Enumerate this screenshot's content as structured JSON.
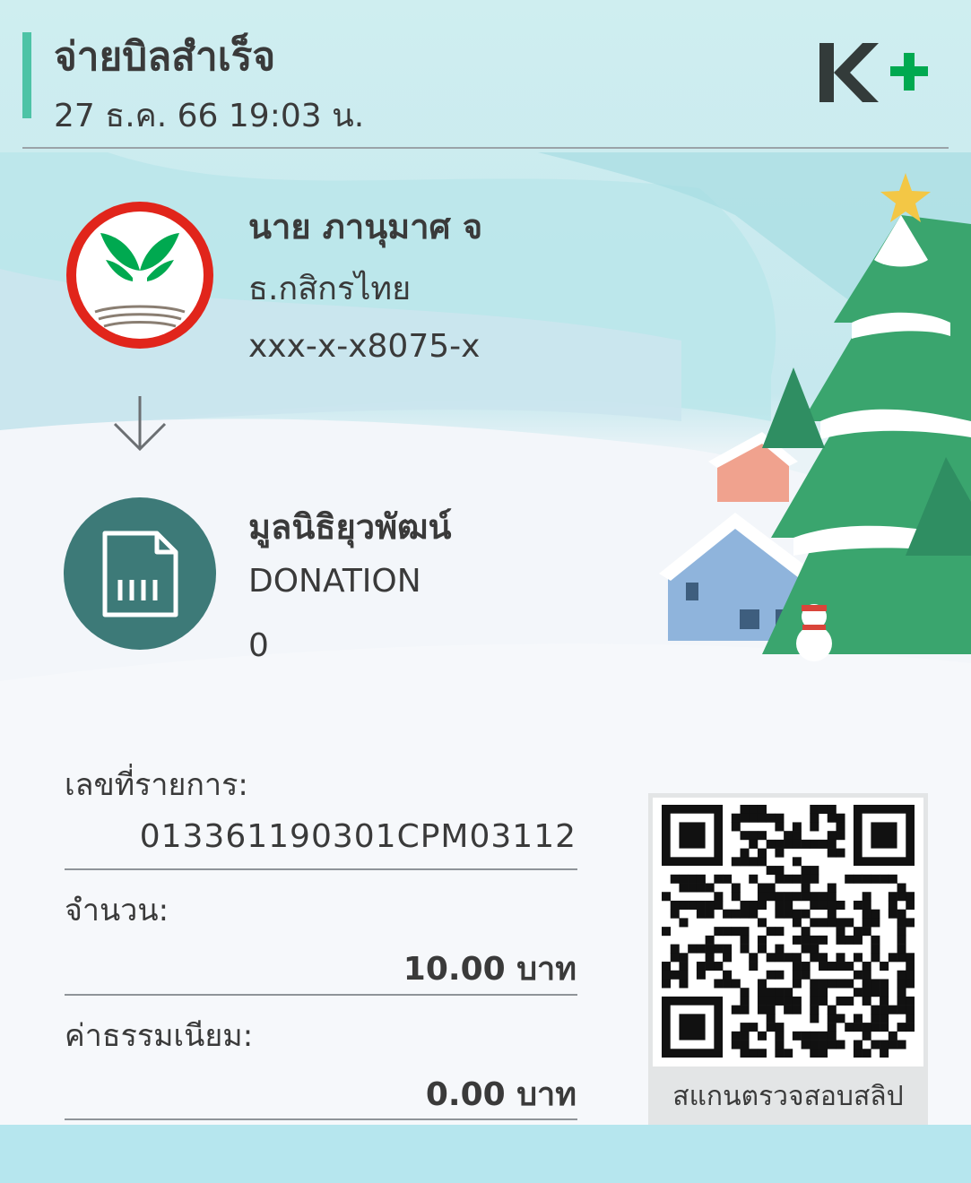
{
  "header": {
    "title": "จ่ายบิลสำเร็จ",
    "datetime": "27 ธ.ค. 66  19:03 น.",
    "logo": "K+"
  },
  "sender": {
    "name": "นาย ภานุมาศ จ",
    "bank": "ธ.กสิกรไทย",
    "account": "xxx-x-x8075-x",
    "logo_icon": "kasikorn-bank-logo"
  },
  "receiver": {
    "name": "มูลนิธิยุวพัฒน์",
    "type": "DONATION",
    "reference": "0",
    "icon": "bill-document-icon"
  },
  "details": {
    "transaction_label": "เลขที่รายการ:",
    "transaction_value": "013361190301CPM03112",
    "amount_label": "จำนวน:",
    "amount_value": "10.00 บาท",
    "fee_label": "ค่าธรรมเนียม:",
    "fee_value": "0.00 บาท"
  },
  "qr": {
    "caption": "สแกนตรวจสอบสลิป"
  },
  "colors": {
    "accent_green": "#4dc3a6",
    "kbank_green": "#00a950",
    "kbank_red": "#e1251b",
    "biller_teal": "#3d7a78",
    "text": "#3a3a3a"
  }
}
